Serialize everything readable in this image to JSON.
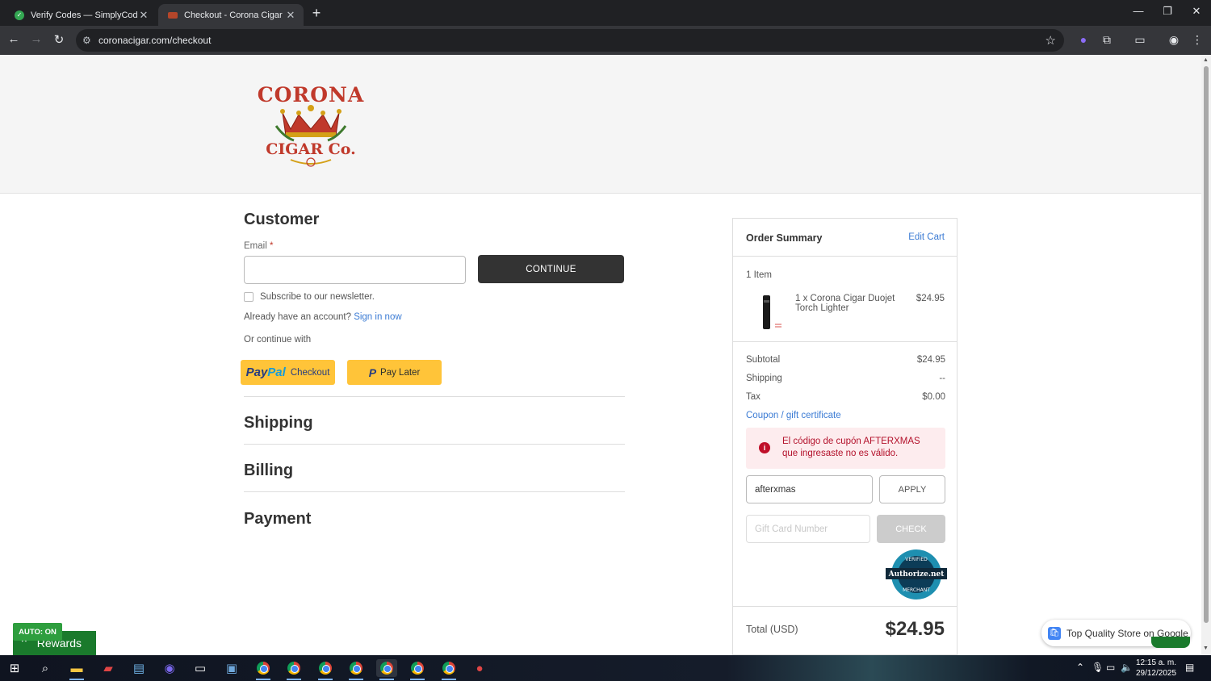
{
  "browser": {
    "tabs": [
      {
        "title": "Verify Codes — SimplyCodes",
        "close": "✕"
      },
      {
        "title": "Checkout - Corona Cigar Co.",
        "close": "✕"
      }
    ],
    "new_tab": "+",
    "url": "coronacigar.com/checkout"
  },
  "header": {
    "logo_text_top": "CORONA",
    "logo_text_bottom": "CIGAR Co."
  },
  "customer": {
    "title": "Customer",
    "email_label": "Email",
    "required_mark": "*",
    "email_value": "",
    "continue_label": "CONTINUE",
    "newsletter_label": "Subscribe to our newsletter.",
    "account_prompt": "Already have an account?",
    "sign_in_label": "Sign in now",
    "or_continue": "Or continue with",
    "paypal_logo_pay": "Pay",
    "paypal_logo_pal": "Pal",
    "paypal_label": "Checkout",
    "paylater_icon": "P",
    "paylater_label": "Pay Later"
  },
  "sections": {
    "shipping": "Shipping",
    "billing": "Billing",
    "payment": "Payment"
  },
  "summary": {
    "title": "Order Summary",
    "edit_cart": "Edit Cart",
    "item_count": "1 Item",
    "items": [
      {
        "name": "1 x Corona Cigar Duojet Torch Lighter",
        "price": "$24.95"
      }
    ],
    "subtotal_label": "Subtotal",
    "subtotal_value": "$24.95",
    "shipping_label": "Shipping",
    "shipping_value": "--",
    "tax_label": "Tax",
    "tax_value": "$0.00",
    "coupon_link": "Coupon / gift certificate",
    "error_message": "El código de cupón AFTERXMAS que ingresaste no es válido.",
    "coupon_value": "afterxmas",
    "apply_label": "APPLY",
    "gift_placeholder": "Gift Card Number",
    "check_label": "CHECK",
    "authnet_text": "Authorize.net",
    "authnet_verified": "VERIFIED",
    "authnet_merchant": "MERCHANT",
    "total_label": "Total (USD)",
    "total_value": "$24.95"
  },
  "overlays": {
    "auto_on": "AUTO: ON",
    "rewards": "Rewards",
    "google_badge": "Top Quality Store on Google"
  },
  "taskbar": {
    "time": "12:15 a. m.",
    "date": "29/12/2025"
  }
}
